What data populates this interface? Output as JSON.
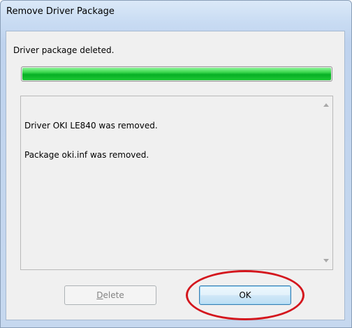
{
  "window": {
    "title": "Remove Driver Package"
  },
  "status": {
    "text": "Driver package deleted.",
    "progress": 1.0,
    "progress_color": "#06b025"
  },
  "log": {
    "lines": [
      "Driver OKI LE840 was removed.",
      "Package oki.inf was removed."
    ],
    "scroll_up_icon": "scroll-up-arrow-icon",
    "scroll_down_icon": "scroll-down-arrow-icon"
  },
  "buttons": {
    "delete_prefix": "",
    "delete_mnemonic": "D",
    "delete_suffix": "elete",
    "delete_enabled": false,
    "ok_label": "OK"
  },
  "annotation": {
    "color": "#d4161d",
    "target": "ok-button"
  }
}
